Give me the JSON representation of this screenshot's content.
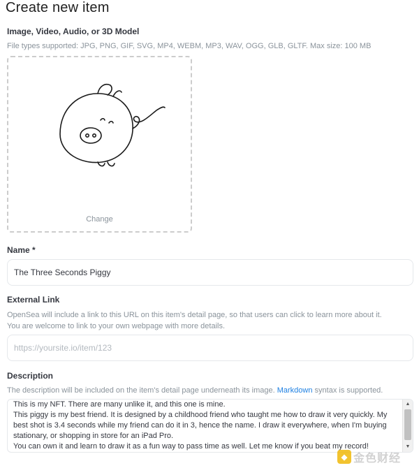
{
  "page": {
    "title": "Create new item"
  },
  "media": {
    "label": "Image, Video, Audio, or 3D Model",
    "help": "File types supported: JPG, PNG, GIF, SVG, MP4, WEBM, MP3, WAV, OGG, GLB, GLTF. Max size: 100 MB",
    "change_label": "Change",
    "preview_icon": "pig-drawing"
  },
  "name_field": {
    "label": "Name *",
    "value": "The Three Seconds Piggy"
  },
  "external_link": {
    "label": "External Link",
    "help_line1": "OpenSea will include a link to this URL on this item's detail page, so that users can click to learn more about it.",
    "help_line2": "You are welcome to link to your own webpage with more details.",
    "placeholder": "https://yoursite.io/item/123"
  },
  "description": {
    "label": "Description",
    "help_before": "The description will be included on the item's detail page underneath its image. ",
    "help_link": "Markdown",
    "help_after": " syntax is supported.",
    "value": "This is my NFT. There are many unlike it, and this one is mine.\nThis piggy is my best friend. It is designed by a childhood friend who taught me how to draw it very quickly. My best shot is 3.4 seconds while my friend can do it in 3, hence the name. I draw it everywhere, when I'm buying stationary, or shopping in store for an iPad Pro.\nYou can own it and learn to draw it as a fun way to pass time as well. Let me know if you beat my record!"
  },
  "watermark": {
    "text": "金色财经",
    "logo_color": "#f0b90b"
  },
  "colors": {
    "accent": "#2081e2",
    "muted": "#8a939b",
    "border": "#e5e8eb"
  }
}
